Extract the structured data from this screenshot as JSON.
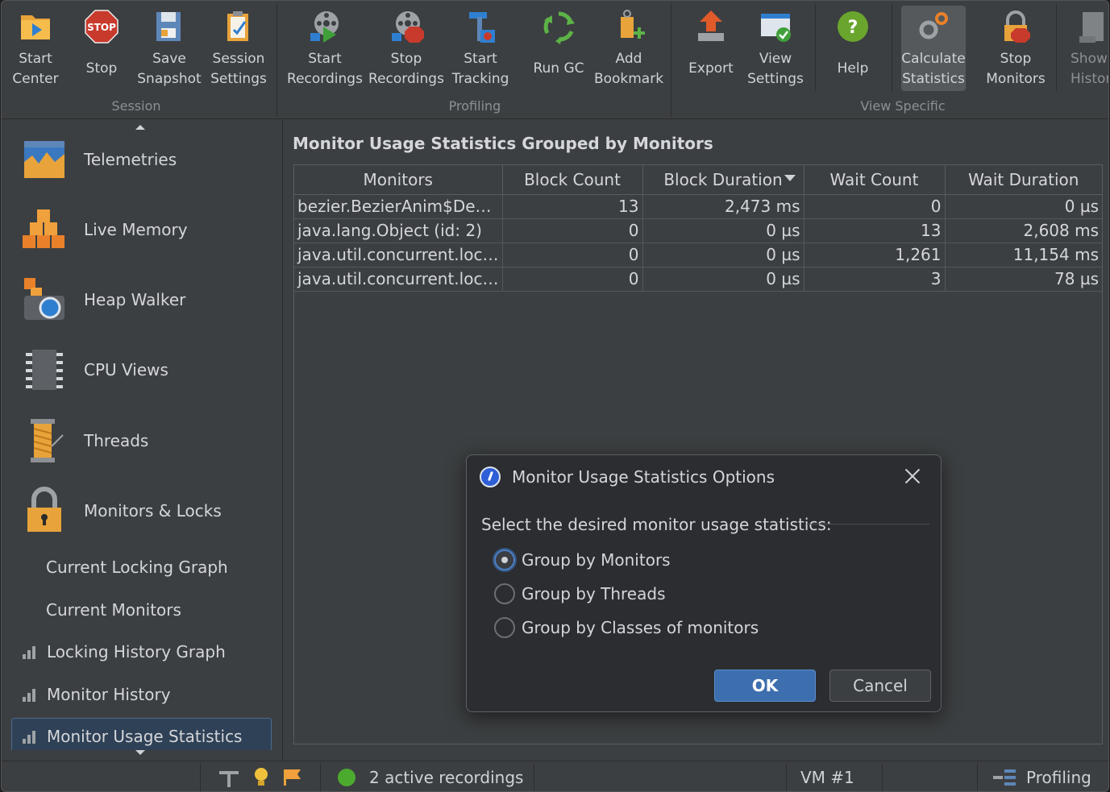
{
  "toolbar": {
    "groups": {
      "session": "Session",
      "profiling": "Profiling",
      "view_specific": "View Specific"
    },
    "buttons": {
      "start_center": "Start\nCenter",
      "stop": "Stop",
      "save_snapshot": "Save\nSnapshot",
      "session_settings": "Session\nSettings",
      "start_recordings": "Start\nRecordings",
      "stop_recordings": "Stop\nRecordings",
      "start_tracking": "Start\nTracking",
      "run_gc": "Run GC",
      "add_bookmark": "Add\nBookmark",
      "export": "Export",
      "view_settings": "View\nSettings",
      "help": "Help",
      "calculate_statistics": "Calculate\nStatistics",
      "stop_monitors": "Stop\nMonitors",
      "show_history": "Show\nHistor"
    },
    "stop_badge": "STOP"
  },
  "sidebar": {
    "main_items": [
      "Telemetries",
      "Live Memory",
      "Heap Walker",
      "CPU Views",
      "Threads",
      "Monitors & Locks"
    ],
    "sub_items": [
      "Current Locking Graph",
      "Current Monitors",
      "Locking History Graph",
      "Monitor History",
      "Monitor Usage Statistics"
    ],
    "selected": "Monitor Usage Statistics"
  },
  "main": {
    "title": "Monitor Usage Statistics Grouped by Monitors",
    "columns": [
      "Monitors",
      "Block Count",
      "Block Duration",
      "Wait Count",
      "Wait Duration"
    ],
    "sorted_column": "Block Duration",
    "rows": [
      [
        "bezier.BezierAnim$Demo...",
        "13",
        "2,473 ms",
        "0",
        "0 µs"
      ],
      [
        "java.lang.Object (id: 2)",
        "0",
        "0 µs",
        "13",
        "2,608 ms"
      ],
      [
        "java.util.concurrent.locks....",
        "0",
        "0 µs",
        "1,261",
        "11,154 ms"
      ],
      [
        "java.util.concurrent.locks....",
        "0",
        "0 µs",
        "3",
        "78 µs"
      ]
    ]
  },
  "dialog": {
    "title": "Monitor Usage Statistics Options",
    "prompt": "Select the desired monitor usage statistics:",
    "options": [
      "Group by Monitors",
      "Group by Threads",
      "Group by Classes of monitors"
    ],
    "selected_option": "Group by Monitors",
    "ok_label": "OK",
    "cancel_label": "Cancel"
  },
  "statusbar": {
    "recordings": "2 active recordings",
    "vm": "VM #1",
    "mode": "Profiling"
  },
  "colors": {
    "accent": "#3d6eae",
    "selection": "#2f4156",
    "background": "#3c3f41"
  }
}
